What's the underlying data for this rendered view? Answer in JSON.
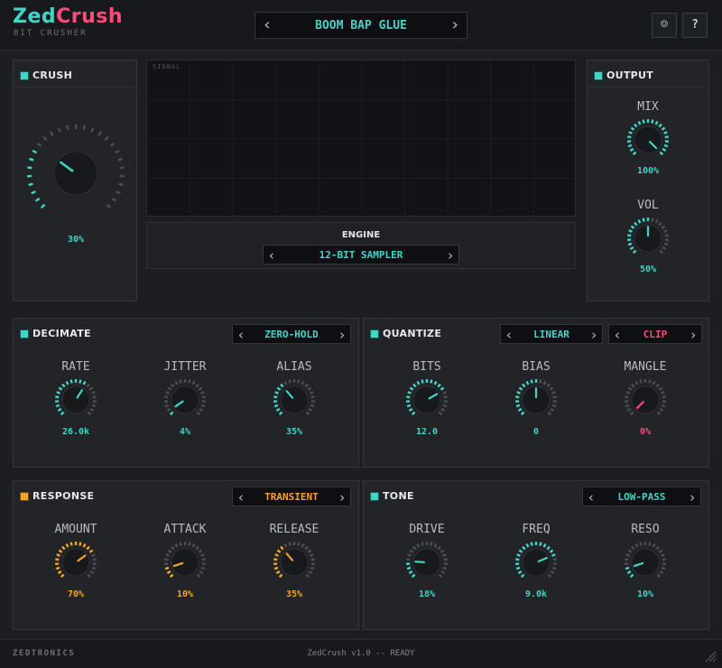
{
  "header": {
    "logo_part1": "Zed",
    "logo_part2": "Crush",
    "subtitle": "BIT CRUSHER",
    "preset": "BOOM BAP GLUE",
    "prev_glyph": "‹",
    "next_glyph": "›",
    "theme_glyph": "☺",
    "help_glyph": "?"
  },
  "colors": {
    "teal": "#3fd6c7",
    "pink": "#ff4b77",
    "orange": "#f5a623",
    "bg": "#1c1e22"
  },
  "crush": {
    "title": "CRUSH",
    "value": 0.3,
    "value_label": "30%"
  },
  "scope": {
    "label": "SIGNAL"
  },
  "engine": {
    "label": "ENGINE",
    "value": "12-BIT SAMPLER"
  },
  "output": {
    "title": "OUTPUT",
    "knobs": [
      {
        "name": "MIX",
        "value": 1.0,
        "display": "100%"
      },
      {
        "name": "VOL",
        "value": 0.5,
        "display": "50%"
      }
    ]
  },
  "decimate": {
    "title": "DECIMATE",
    "mode": "ZERO-HOLD",
    "knobs": [
      {
        "name": "RATE",
        "value": 0.62,
        "display": "26.0k"
      },
      {
        "name": "JITTER",
        "value": 0.04,
        "display": "4%"
      },
      {
        "name": "ALIAS",
        "value": 0.35,
        "display": "35%"
      }
    ]
  },
  "quantize": {
    "title": "QUANTIZE",
    "mode": "LINEAR",
    "clip": "CLIP",
    "knobs": [
      {
        "name": "BITS",
        "value": 0.72,
        "display": "12.0"
      },
      {
        "name": "BIAS",
        "value": 0.5,
        "display": "0"
      },
      {
        "name": "MANGLE",
        "value": 0.0,
        "display": "0%"
      }
    ]
  },
  "response": {
    "title": "RESPONSE",
    "mode": "TRANSIENT",
    "knobs": [
      {
        "name": "AMOUNT",
        "value": 0.7,
        "display": "70%"
      },
      {
        "name": "ATTACK",
        "value": 0.1,
        "display": "10%"
      },
      {
        "name": "RELEASE",
        "value": 0.35,
        "display": "35%"
      }
    ]
  },
  "tone": {
    "title": "TONE",
    "mode": "LOW-PASS",
    "knobs": [
      {
        "name": "DRIVE",
        "value": 0.18,
        "display": "18%"
      },
      {
        "name": "FREQ",
        "value": 0.75,
        "display": "9.0k"
      },
      {
        "name": "RESO",
        "value": 0.1,
        "display": "10%"
      }
    ]
  },
  "footer": {
    "brand": "ZEDTRONICS",
    "status": "ZedCrush v1.0 -- READY"
  }
}
